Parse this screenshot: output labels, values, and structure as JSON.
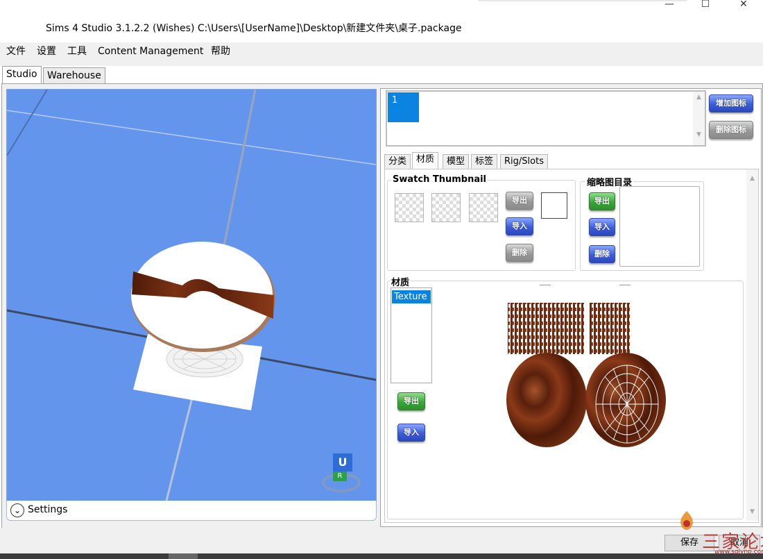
{
  "window": {
    "title": "Sims 4 Studio 3.1.2.2 (Wishes)  C:\\Users\\[UserName]\\Desktop\\新建文件夹\\桌子.package",
    "minimize_glyph": "—",
    "maximize_glyph": "☐",
    "close_glyph": "✕"
  },
  "menu": {
    "items": [
      "文件",
      "设置",
      "工具",
      "Content Management",
      "帮助"
    ]
  },
  "main_tabs": [
    {
      "label": "Studio",
      "active": true
    },
    {
      "label": "Warehouse",
      "active": false
    }
  ],
  "viewport": {
    "settings_label": "Settings",
    "gizmo_top": "U",
    "gizmo_side": "R"
  },
  "swatches": {
    "items": [
      "1"
    ],
    "add_label": "增加图标",
    "delete_label": "删除图标"
  },
  "sub_tabs": [
    {
      "label": "分类",
      "active": false
    },
    {
      "label": "材质",
      "active": true
    },
    {
      "label": "模型",
      "active": false
    },
    {
      "label": "标签",
      "active": false
    },
    {
      "label": "Rig/Slots",
      "active": false
    }
  ],
  "swatch_thumbnail": {
    "title": "Swatch Thumbnail",
    "export_label": "导出",
    "import_label": "导入",
    "delete_label": "删除"
  },
  "thumbnail_catalog": {
    "title": "缩略图目录",
    "export_label": "导出",
    "import_label": "导入",
    "delete_label": "删除"
  },
  "material": {
    "title": "材质",
    "list_items": [
      "Texture"
    ],
    "export_label": "导出",
    "import_label": "导入"
  },
  "bottom": {
    "save_label": "保存",
    "cancel_label": "取消"
  },
  "watermark": {
    "text": "三家论坛",
    "url": "www.sglynp.com"
  },
  "colors": {
    "viewport_bg": "#6495ed",
    "selection": "#0a84e0",
    "wood": "#6b2a10"
  }
}
